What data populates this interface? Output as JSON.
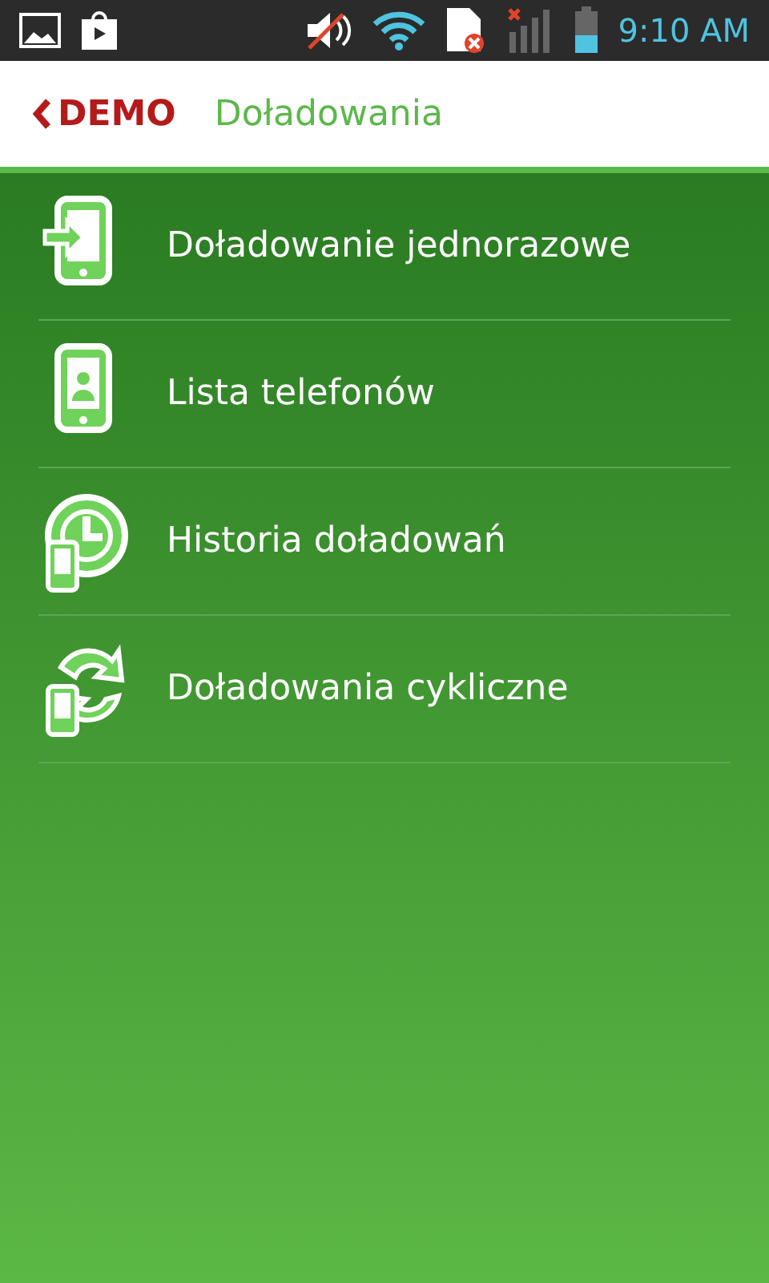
{
  "status_bar": {
    "time": "9:10 AM"
  },
  "header": {
    "back_label": "DEMO",
    "title": "Doładowania"
  },
  "menu": [
    {
      "kind": "phone-arrow",
      "label": "Doładowanie jednorazowe"
    },
    {
      "kind": "phone-person",
      "label": "Lista telefonów"
    },
    {
      "kind": "clock-phone",
      "label": "Historia doładowań"
    },
    {
      "kind": "cycle-phone",
      "label": "Doładowania cykliczne"
    }
  ]
}
